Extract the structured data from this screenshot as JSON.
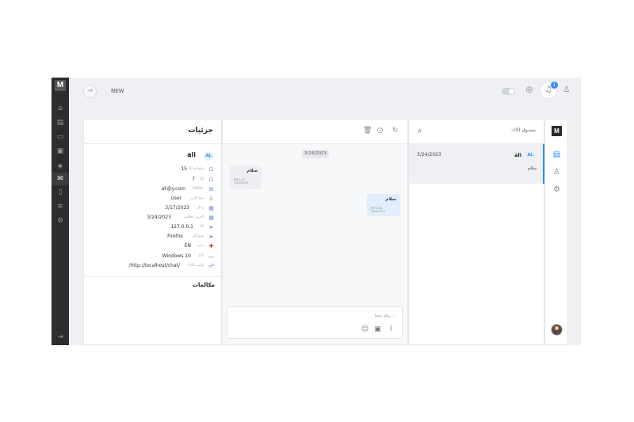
{
  "topbar": {
    "back_icon": "arrow-right-icon",
    "title": "NEW",
    "notification_count": "1"
  },
  "rail": {
    "logo": "M",
    "items": [
      "home-icon",
      "document-icon",
      "image-icon",
      "briefcase-icon",
      "paint-bucket-icon",
      "mail-icon",
      "phone-icon",
      "list-icon",
      "settings-icon"
    ],
    "logout": "logout-icon"
  },
  "details": {
    "title": "جزئیات",
    "user_name": "ali",
    "avatar_initials": "AL",
    "rows": [
      {
        "icon": "lock-icon",
        "label": "ID ماهیانه",
        "value": "15"
      },
      {
        "icon": "lock-icon",
        "label": "ID",
        "value": "7"
      },
      {
        "icon": "mail-icon",
        "label": "EMAIL",
        "value": "ali@y.com"
      },
      {
        "icon": "user-icon",
        "label": "نوع کاربر",
        "value": "User"
      },
      {
        "icon": "calendar-icon",
        "label": "زمان",
        "value": "3/17/2023"
      },
      {
        "icon": "calendar-icon",
        "label": "آخرین فعالیت",
        "value": "3/24/2023"
      },
      {
        "icon": "send-icon",
        "label": "IP",
        "value": "127.0.0.1"
      },
      {
        "icon": "send-icon",
        "label": "مرورگر",
        "value": "Firefox"
      },
      {
        "icon": "flag-icon",
        "label": "زبان",
        "value": "EN"
      },
      {
        "icon": "monitor-icon",
        "label": "OS",
        "value": "Windows 10"
      },
      {
        "icon": "link-icon",
        "label": "URL اولیه",
        "value": "/http://localhost/chat/"
      }
    ],
    "calls_title": "مکالمات"
  },
  "chat": {
    "date_chip": "3/24/2023",
    "incoming": {
      "text": "سلام",
      "time": "PM 4:07 3/24/2023"
    },
    "outgoing": {
      "text": "سلام",
      "time": "PM 4:00 3/24/2023"
    },
    "composer_placeholder": "پیام شما ...",
    "toolbar_icons": [
      "trash-icon",
      "clock-icon",
      "refresh-icon"
    ]
  },
  "inbox": {
    "box_label": "صندوق (0)",
    "conversation": {
      "date": "3/24/2023",
      "name": "ali",
      "initials": "AL",
      "message": "سلام"
    }
  },
  "iconcol": {
    "logo": "M"
  },
  "colors": {
    "accent": "#2d8cf0",
    "rail": "#2c2c2c",
    "background": "#eef0f3"
  }
}
